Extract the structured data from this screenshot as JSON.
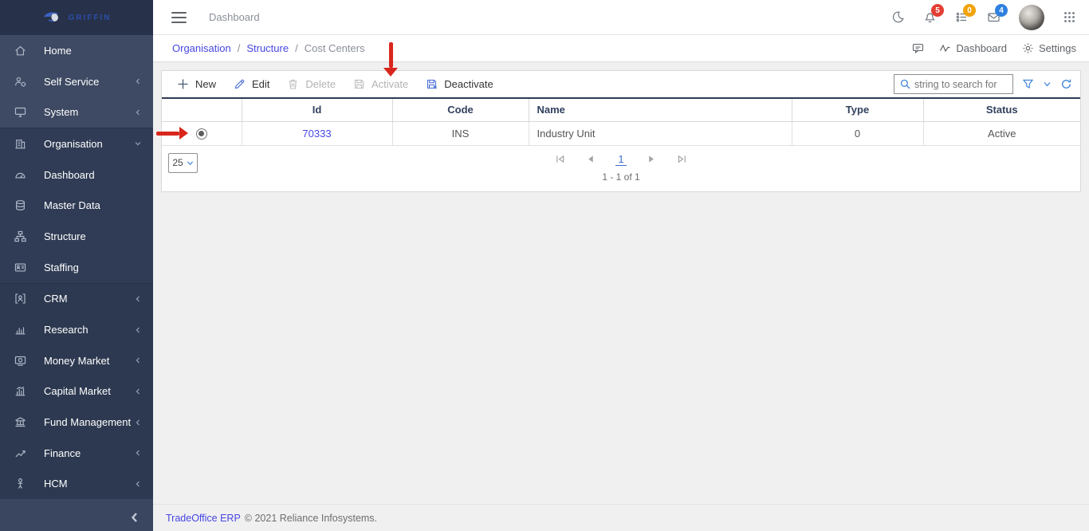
{
  "sidebar": {
    "logo_text": "GRIFFIN",
    "groups": [
      {
        "items": [
          {
            "label": "Home",
            "icon": "home-icon"
          },
          {
            "label": "Self Service",
            "icon": "self-service-icon",
            "chevron": "collapsed"
          },
          {
            "label": "System",
            "icon": "system-icon",
            "chevron": "collapsed"
          }
        ]
      },
      {
        "items": [
          {
            "label": "Organisation",
            "icon": "organisation-icon",
            "chevron": "expanded",
            "active": true
          },
          {
            "label": "Dashboard",
            "icon": "dashboard-icon"
          },
          {
            "label": "Master Data",
            "icon": "master-data-icon"
          },
          {
            "label": "Structure",
            "icon": "structure-icon"
          },
          {
            "label": "Staffing",
            "icon": "staffing-icon"
          }
        ]
      },
      {
        "items": [
          {
            "label": "CRM",
            "icon": "crm-icon",
            "chevron": "collapsed"
          },
          {
            "label": "Research",
            "icon": "research-icon",
            "chevron": "collapsed"
          },
          {
            "label": "Money Market",
            "icon": "money-market-icon",
            "chevron": "collapsed"
          },
          {
            "label": "Capital Market",
            "icon": "capital-market-icon",
            "chevron": "collapsed"
          },
          {
            "label": "Fund Management",
            "icon": "fund-management-icon",
            "chevron": "collapsed"
          },
          {
            "label": "Finance",
            "icon": "finance-icon",
            "chevron": "collapsed"
          },
          {
            "label": "HCM",
            "icon": "hcm-icon",
            "chevron": "collapsed"
          }
        ]
      }
    ]
  },
  "topbar": {
    "title": "Dashboard",
    "notifications": {
      "bell_count": "5",
      "tasks_count": "0",
      "mail_count": "4"
    }
  },
  "breadcrumb": {
    "items": [
      "Organisation",
      "Structure",
      "Cost Centers"
    ],
    "separator": "/"
  },
  "page_actions": {
    "dashboard_label": "Dashboard",
    "settings_label": "Settings"
  },
  "toolbar": {
    "new_label": "New",
    "edit_label": "Edit",
    "delete_label": "Delete",
    "activate_label": "Activate",
    "deactivate_label": "Deactivate",
    "search_placeholder": "string to search for"
  },
  "table": {
    "columns": [
      "",
      "Id",
      "Code",
      "Name",
      "Type",
      "Status"
    ],
    "rows": [
      {
        "id": "70333",
        "code": "INS",
        "name": "Industry Unit",
        "type": "0",
        "status": "Active",
        "selected": true
      }
    ]
  },
  "pagination": {
    "page_size": "25",
    "current_page": "1",
    "range_summary": "1 - 1 of 1"
  },
  "footer": {
    "brand_link": "TradeOffice ERP",
    "copyright": "© 2021 Reliance Infosystems."
  },
  "colors": {
    "accent_link": "#4746e3",
    "toolbar_icon_blue": "#4a6fd8",
    "search_icon_blue": "#4286d8",
    "sidebar_top_group": "#3e4a63",
    "sidebar_dark_group": "#2e3a52",
    "sidebar_bottom_strip": "#3a465f",
    "table_frame_navy": "#2f3b55",
    "annotation_red": "#d9261c",
    "badge_red": "#e23e33",
    "badge_amber": "#f0a30a",
    "badge_blue": "#2f80e0"
  }
}
